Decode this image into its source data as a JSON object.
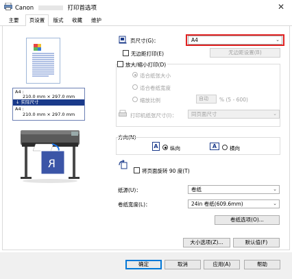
{
  "window": {
    "brand": "Canon",
    "title_rest": "打印首选项",
    "close_glyph": "✕"
  },
  "tabs": [
    {
      "label": "主要"
    },
    {
      "label": "页设置"
    },
    {
      "label": "版式"
    },
    {
      "label": "收藏"
    },
    {
      "label": "维护"
    }
  ],
  "size_info": {
    "line1_label": "A4 :",
    "line2": "210.0 mm × 297.0 mm",
    "actual_label": "↓ 实际尺寸",
    "line3_label": "A4 :",
    "line4": "210.0 mm × 297.0 mm"
  },
  "page_size": {
    "label": "页尺寸(G)：",
    "value": "A4"
  },
  "borderless": {
    "checkbox_label": "无边距打印(E)",
    "settings_button": "无边距设置(B)"
  },
  "scaling": {
    "group_label": "放大/缩小打印(D)",
    "fit_paper": "适合纸张大小",
    "fit_roll": "适合卷纸宽度",
    "scale": "缩放比例",
    "auto_value": "自动",
    "range": "% (5 - 600)",
    "print_size_label": "打印机纸张尺寸(I)：",
    "print_size_value": "同页面尺寸"
  },
  "orientation": {
    "label": "方向(N)",
    "portrait": "纵向",
    "landscape": "横向",
    "portrait_glyph": "A",
    "landscape_glyph": "A"
  },
  "rotate": {
    "label": "将页面旋转 90 度(T)"
  },
  "paper_source": {
    "label": "纸源(U)：",
    "value": "卷纸"
  },
  "roll_width": {
    "label": "卷纸宽度(L)：",
    "value": "24in 卷纸(609.6mm)"
  },
  "buttons": {
    "roll_options": "卷纸选项(O)...",
    "size_options": "大小选项(Z)...",
    "defaults": "默认值(F)",
    "ok": "确定",
    "cancel": "取消",
    "apply": "应用(A)",
    "help": "帮助"
  },
  "colors": {
    "highlight": "#e02020",
    "accent": "#0078d7",
    "info_bar": "#1a3a8a"
  }
}
